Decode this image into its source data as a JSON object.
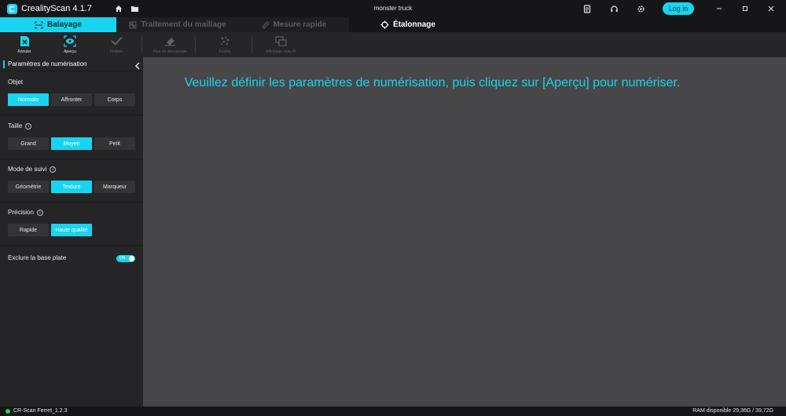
{
  "app": {
    "title": "CrealityScan 4.1.7",
    "project_name": "monster truck",
    "login_label": "Log in"
  },
  "tabs": [
    {
      "label": "Balayage",
      "active": true
    },
    {
      "label": "Traitement du maillage",
      "active": false
    },
    {
      "label": "Mesure rapide",
      "active": false
    },
    {
      "label": "Étalonnage",
      "active": false
    }
  ],
  "toolbar": {
    "items": [
      {
        "label": "Annuler",
        "icon": "cancel-scan-icon",
        "enabled": true
      },
      {
        "label": "Aperçu",
        "icon": "preview-eye-icon",
        "enabled": true
      },
      {
        "label": "Finition",
        "icon": "check-icon",
        "enabled": false
      },
      {
        "label": "Plan de découpage",
        "icon": "eraser-icon",
        "enabled": false
      },
      {
        "label": "Fusion",
        "icon": "fusion-icon",
        "enabled": false
      },
      {
        "label": "Affichage sans fil",
        "icon": "wireless-display-icon",
        "enabled": false
      }
    ]
  },
  "sidebar": {
    "title": "Paramètres de numérisation",
    "sections": [
      {
        "label": "Objet",
        "info": false,
        "options": [
          "Normale",
          "Affronter",
          "Corps"
        ],
        "selected": 0
      },
      {
        "label": "Taille",
        "info": true,
        "options": [
          "Grand",
          "Moyen",
          "Petit"
        ],
        "selected": 1
      },
      {
        "label": "Mode de suivi",
        "info": true,
        "options": [
          "Géométrie",
          "Texture",
          "Marqueur"
        ],
        "selected": 1
      },
      {
        "label": "Précision",
        "info": true,
        "options": [
          "Rapide",
          "Haute qualité"
        ],
        "selected": 1
      }
    ],
    "exclude": {
      "label": "Exclure la base plate",
      "toggle_label": "ON",
      "on": true
    }
  },
  "viewport": {
    "hint": "Veuillez définir les paramètres de numérisation, puis cliquez sur [Aperçu] pour numériser."
  },
  "status": {
    "device": "CR-Scan Ferret_1.2.3",
    "ram": "RAM disponible 29,36G / 39,72G"
  },
  "colors": {
    "accent": "#19d4f0",
    "connected": "#21d061",
    "viewport": "#474749"
  }
}
